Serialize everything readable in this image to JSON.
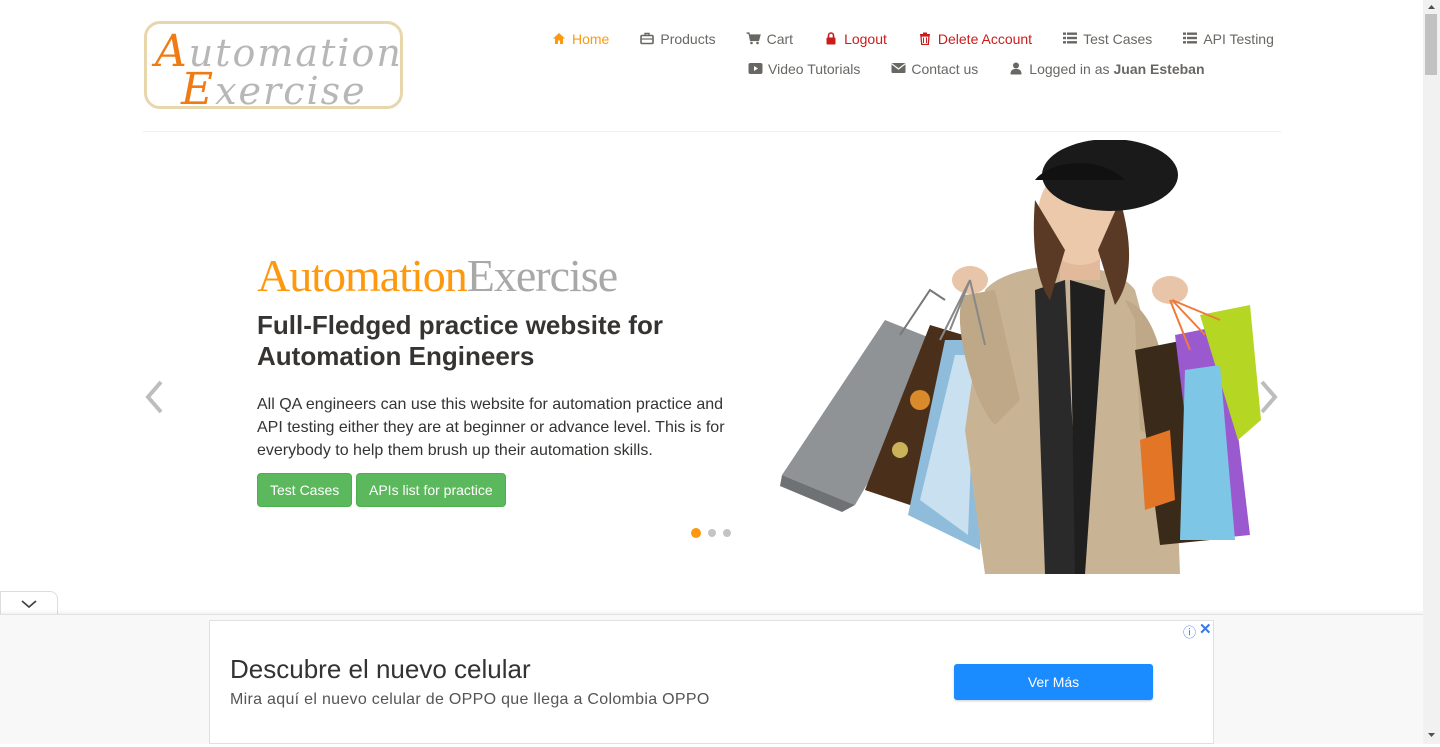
{
  "logo": {
    "line1_cap": "A",
    "line1_rest": "utomation",
    "line2_cap": "E",
    "line2_rest": "xercise"
  },
  "nav": {
    "home": "Home",
    "products": "Products",
    "cart": "Cart",
    "logout": "Logout",
    "delete_account": "Delete Account",
    "test_cases": "Test Cases",
    "api_testing": "API Testing",
    "video_tutorials": "Video Tutorials",
    "contact_us": "Contact us",
    "logged_in_prefix": "Logged in as",
    "username": "Juan Esteban"
  },
  "slider": {
    "brand_part1": "Automation",
    "brand_part2": "Exercise",
    "headline": "Full-Fledged practice website for Automation Engineers",
    "description": "All QA engineers can use this website for automation practice and API testing either they are at beginner or advance level. This is for everybody to help them brush up their automation skills.",
    "btn_test_cases": "Test Cases",
    "btn_apis": "APIs list for practice",
    "active_slide": 1,
    "total_slides": 3
  },
  "ad": {
    "title": "Descubre el nuevo celular",
    "subtitle": "Mira aquí el nuevo celular de OPPO que llega a Colombia OPPO",
    "cta": "Ver Más",
    "info": "ⓘ",
    "close": "✕"
  },
  "colors": {
    "accent": "#fe980f",
    "danger": "#cb1c1c",
    "button_green": "#5cb85c",
    "ad_blue": "#1a8cff"
  },
  "icons": {
    "home": "home-icon",
    "products": "briefcase-icon",
    "cart": "cart-icon",
    "logout": "lock-icon",
    "delete": "trash-icon",
    "test_cases": "list-icon",
    "api_testing": "list-icon",
    "video": "play-icon",
    "contact": "envelope-icon",
    "user": "user-icon"
  }
}
